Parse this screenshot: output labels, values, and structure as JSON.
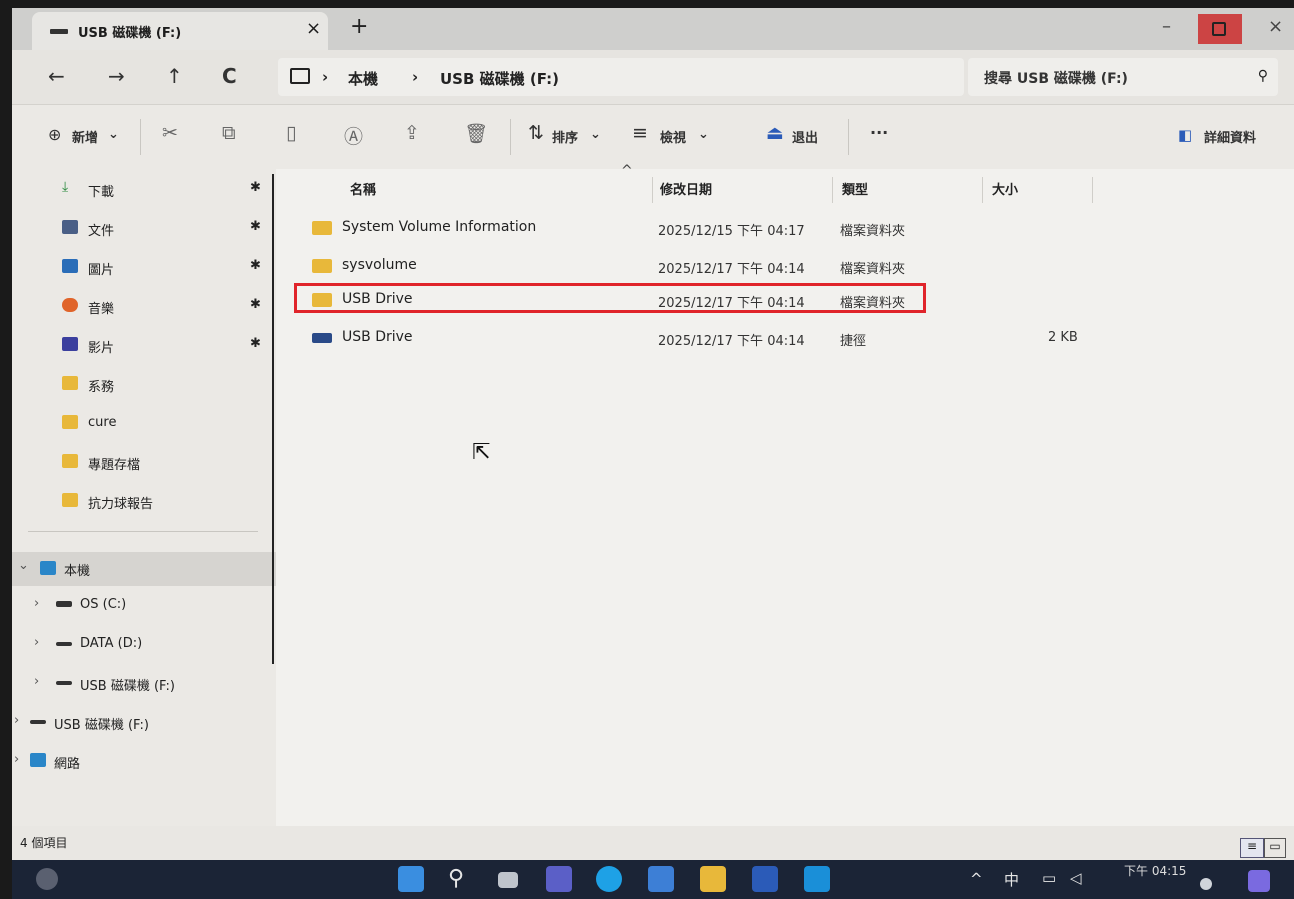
{
  "window": {
    "tab_title": "USB 磁碟機 (F:)",
    "tab_close": "×",
    "new_tab": "+",
    "minimize": "–",
    "close": "×"
  },
  "nav": {
    "back": "←",
    "forward": "→",
    "up": "↑",
    "refresh": "C"
  },
  "breadcrumb": {
    "sep1": "›",
    "item1": "本機",
    "sep2": "›",
    "item2": "USB 磁碟機 (F:)"
  },
  "search": {
    "placeholder": "搜尋 USB 磁碟機 (F:)",
    "icon": "⚲"
  },
  "toolbar": {
    "new_label": "新增",
    "new_caret": "⌄",
    "sort_label": "排序",
    "sort_caret": "⌄",
    "view_label": "檢視",
    "view_caret": "⌄",
    "eject_label": "退出",
    "more": "···",
    "details_label": "詳細資料"
  },
  "sidebar": {
    "items": [
      {
        "label": "下載",
        "pinned": true,
        "icon": "download-icon"
      },
      {
        "label": "文件",
        "pinned": true,
        "icon": "document-icon"
      },
      {
        "label": "圖片",
        "pinned": true,
        "icon": "picture-icon"
      },
      {
        "label": "音樂",
        "pinned": true,
        "icon": "music-icon"
      },
      {
        "label": "影片",
        "pinned": true,
        "icon": "video-icon"
      },
      {
        "label": "系務",
        "pinned": false,
        "icon": "folder-icon"
      },
      {
        "label": "cure",
        "pinned": false,
        "icon": "folder-icon"
      },
      {
        "label": "專題存檔",
        "pinned": false,
        "icon": "folder-icon"
      },
      {
        "label": "抗力球報告",
        "pinned": false,
        "icon": "folder-icon"
      }
    ],
    "pin_glyph": "✱",
    "this_pc": "本機",
    "expand_open": "⌄",
    "expand_closed": "›",
    "drives": [
      {
        "label": "OS (C:)"
      },
      {
        "label": "DATA (D:)"
      },
      {
        "label": "USB 磁碟機 (F:)"
      }
    ],
    "usb_root": "USB 磁碟機 (F:)",
    "network": "網路"
  },
  "columns": {
    "name": "名稱",
    "date": "修改日期",
    "type": "類型",
    "size": "大小",
    "sort_indicator": "^"
  },
  "files": [
    {
      "name": "System Volume Information",
      "date": "2025/12/15 下午 04:17",
      "type": "檔案資料夾",
      "size": ""
    },
    {
      "name": "sysvolume",
      "date": "2025/12/17 下午 04:14",
      "type": "檔案資料夾",
      "size": ""
    },
    {
      "name": "USB Drive",
      "date": "2025/12/17 下午 04:14",
      "type": "檔案資料夾",
      "size": ""
    },
    {
      "name": "USB Drive",
      "date": "2025/12/17 下午 04:14",
      "type": "捷徑",
      "size": "2 KB"
    }
  ],
  "status": {
    "item_count": "4 個項目"
  },
  "taskbar": {
    "tray_caret": "^",
    "ime": "中",
    "clock_time": "下午 04:15"
  },
  "colors": {
    "highlight_border": "#e0242a",
    "folder": "#e8b83a",
    "taskbar": "#1b2436"
  }
}
